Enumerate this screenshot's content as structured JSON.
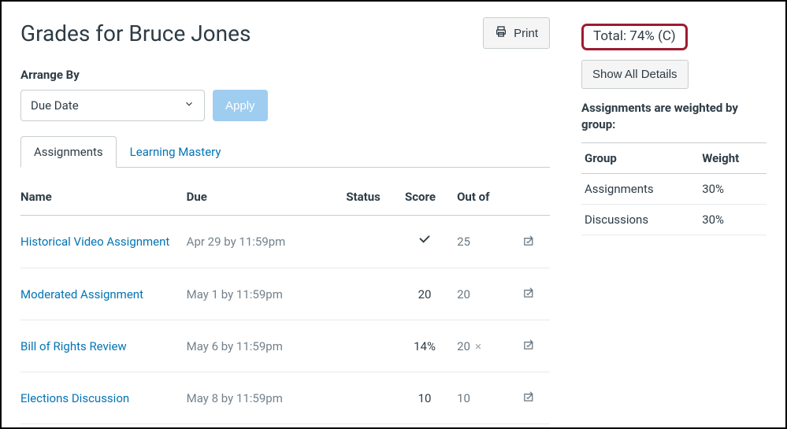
{
  "header": {
    "title": "Grades for Bruce Jones",
    "print_label": "Print"
  },
  "arrange": {
    "label": "Arrange By",
    "selected": "Due Date",
    "apply_label": "Apply"
  },
  "tabs": {
    "active": "Assignments",
    "inactive": "Learning Mastery"
  },
  "columns": {
    "name": "Name",
    "due": "Due",
    "status": "Status",
    "score": "Score",
    "outof": "Out of"
  },
  "rows": [
    {
      "name": "Historical Video Assignment",
      "due": "Apr 29 by 11:59pm",
      "score_kind": "check",
      "score": "",
      "outof": "25",
      "mult": ""
    },
    {
      "name": "Moderated Assignment",
      "due": "May 1 by 11:59pm",
      "score_kind": "num",
      "score": "20",
      "outof": "20",
      "mult": ""
    },
    {
      "name": "Bill of Rights Review",
      "due": "May 6 by 11:59pm",
      "score_kind": "num",
      "score": "14%",
      "outof": "20",
      "mult": "×"
    },
    {
      "name": "Elections Discussion",
      "due": "May 8 by 11:59pm",
      "score_kind": "num",
      "score": "10",
      "outof": "10",
      "mult": ""
    }
  ],
  "sidebar": {
    "total": "Total: 74% (C)",
    "show_details": "Show All Details",
    "weighted_text": "Assignments are weighted by group:",
    "weight_headers": {
      "group": "Group",
      "weight": "Weight"
    },
    "weight_rows": [
      {
        "group": "Assignments",
        "weight": "30%"
      },
      {
        "group": "Discussions",
        "weight": "30%"
      }
    ]
  }
}
